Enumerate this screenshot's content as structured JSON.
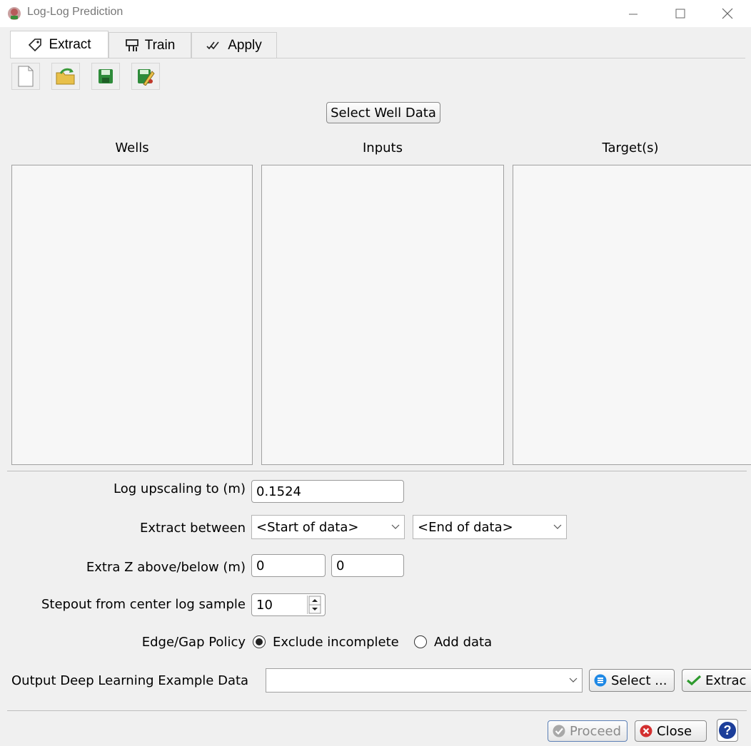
{
  "window": {
    "title": "Log-Log Prediction"
  },
  "tabs": [
    {
      "label": "Extract",
      "icon": "tag-icon",
      "active": true
    },
    {
      "label": "Train",
      "icon": "train-icon",
      "active": false
    },
    {
      "label": "Apply",
      "icon": "double-check-icon",
      "active": false
    }
  ],
  "toolbar": [
    "new-file-icon",
    "open-folder-icon",
    "save-icon",
    "save-as-icon"
  ],
  "select_well_label": "Select Well Data",
  "columns": {
    "wells": "Wells",
    "inputs": "Inputs",
    "targets": "Target(s)"
  },
  "form": {
    "upscale_label": "Log upscaling to (m)",
    "upscale_value": "0.1524",
    "between_label": "Extract between",
    "start_value": "<Start of data>",
    "end_value": "<End of data>",
    "extraz_label": "Extra Z above/below (m)",
    "extraz_above": "0",
    "extraz_below": "0",
    "stepout_label": "Stepout from center log sample",
    "stepout_value": "10",
    "policy_label": "Edge/Gap Policy",
    "policy_exclude": "Exclude incomplete",
    "policy_add": "Add data",
    "policy_selected": "Exclude incomplete",
    "output_label": "Output Deep Learning Example Data",
    "output_value": "",
    "select_label": "Select ...",
    "extract_label": "Extrac"
  },
  "footer": {
    "proceed_label": "Proceed",
    "close_label": "Close",
    "help_label": "?"
  }
}
